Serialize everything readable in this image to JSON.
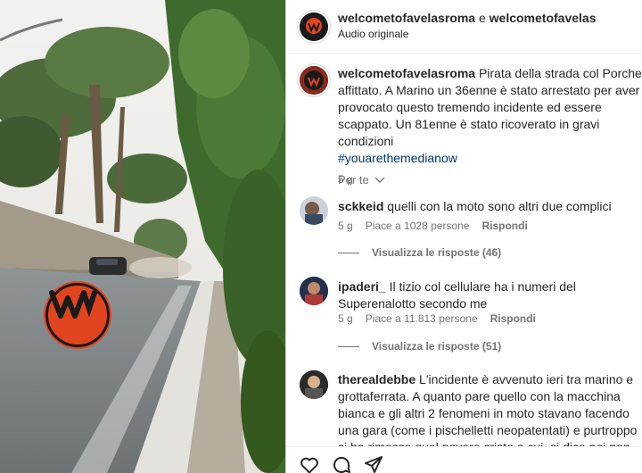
{
  "post": {
    "authors": "welcometofavelasroma e welcometofavelas",
    "author_1": "welcometofavelasroma",
    "joiner": " e ",
    "author_2": "welcometofavelas",
    "audio": "Audio originale",
    "caption_user": "welcometofavelasroma",
    "caption_text": " Pirata della strada col Porche affittato. A Marino un 36enne è stato arrestato per aver provocato questo tremendo incidente ed essere scappato. Un 81enne è stato ricoverato in gravi condizioni",
    "hashtag": "#youarethemedianow",
    "time": "5 g",
    "for_you": "Per te"
  },
  "comments": [
    {
      "user": "sckkeid",
      "text": " quelli con la moto sono altri due complici",
      "time": "5 g",
      "likes": "Piace a 1028 persone",
      "reply": "Rispondi",
      "view_replies": "Visualizza le risposte (46)"
    },
    {
      "user": "ipaderi_",
      "text": " Il tizio col cellulare ha i numeri del Superenalotto secondo me",
      "time": "5 g",
      "likes": "Piace a 11.813 persone",
      "reply": "Rispondi",
      "view_replies": "Visualizza le risposte (51)"
    },
    {
      "user": "therealdebbe",
      "text": " L'incidente è avvenuto ieri tra marino e grottaferrata. A quanto pare quello con la macchina bianca e gli altri 2 fenomeni in moto stavano facendo una gara (come i pischelletti neopatentati) e purtroppo ci ha rimesso quel povero cristo a cui, si dice poi non so, siano state tagliate le"
    }
  ],
  "icons": {
    "like": "heart-icon",
    "comment": "comment-icon",
    "share": "share-icon"
  },
  "colors": {
    "brand_orange": "#e0451f",
    "link_blue": "#00376b",
    "muted": "#737373"
  }
}
